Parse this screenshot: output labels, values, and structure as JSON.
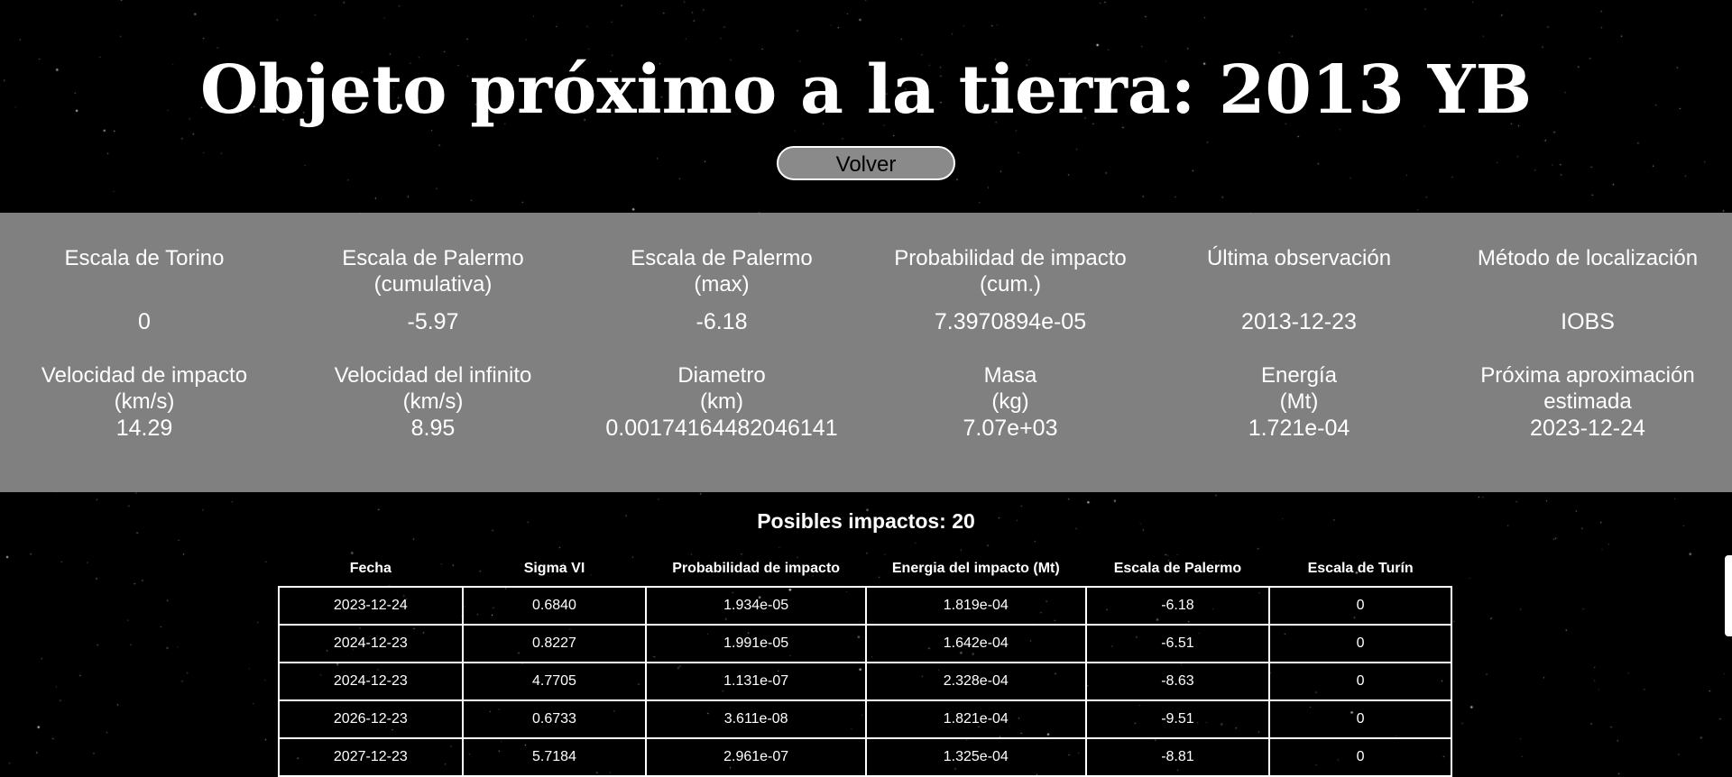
{
  "header": {
    "title": "Objeto próximo a la tierra: 2013 YB",
    "back_label": "Volver"
  },
  "info": {
    "row1": [
      {
        "label": "Escala de Torino",
        "value": "0"
      },
      {
        "label": "Escala de Palermo\n(cumulativa)",
        "value": "-5.97"
      },
      {
        "label": "Escala de Palermo\n(max)",
        "value": "-6.18"
      },
      {
        "label": "Probabilidad de impacto\n(cum.)",
        "value": "7.3970894e-05"
      },
      {
        "label": "Última observación",
        "value": "2013-12-23"
      },
      {
        "label": "Método de localización",
        "value": "IOBS"
      }
    ],
    "row2": [
      {
        "label": "Velocidad de impacto\n(km/s)",
        "value": "14.29"
      },
      {
        "label": "Velocidad del infinito\n(km/s)",
        "value": "8.95"
      },
      {
        "label": "Diametro\n(km)",
        "value": "0.00174164482046141"
      },
      {
        "label": "Masa\n(kg)",
        "value": "7.07e+03"
      },
      {
        "label": "Energía\n(Mt)",
        "value": "1.721e-04"
      },
      {
        "label": "Próxima aproximación\nestimada",
        "value": "2023-12-24"
      }
    ]
  },
  "impacts": {
    "title": "Posibles impactos: 20",
    "columns": [
      "Fecha",
      "Sigma VI",
      "Probabilidad de impacto",
      "Energia del impacto (Mt)",
      "Escala de Palermo",
      "Escala de Turín"
    ],
    "rows": [
      [
        "2023-12-24",
        "0.6840",
        "1.934e-05",
        "1.819e-04",
        "-6.18",
        "0"
      ],
      [
        "2024-12-23",
        "0.8227",
        "1.991e-05",
        "1.642e-04",
        "-6.51",
        "0"
      ],
      [
        "2024-12-23",
        "4.7705",
        "1.131e-07",
        "2.328e-04",
        "-8.63",
        "0"
      ],
      [
        "2026-12-23",
        "0.6733",
        "3.611e-08",
        "1.821e-04",
        "-9.51",
        "0"
      ],
      [
        "2027-12-23",
        "5.7184",
        "2.961e-07",
        "1.325e-04",
        "-8.81",
        "0"
      ]
    ]
  },
  "colors": {
    "background": "#000000",
    "panel": "#808080",
    "button_bg": "#8a8a8a",
    "text": "#ffffff"
  }
}
